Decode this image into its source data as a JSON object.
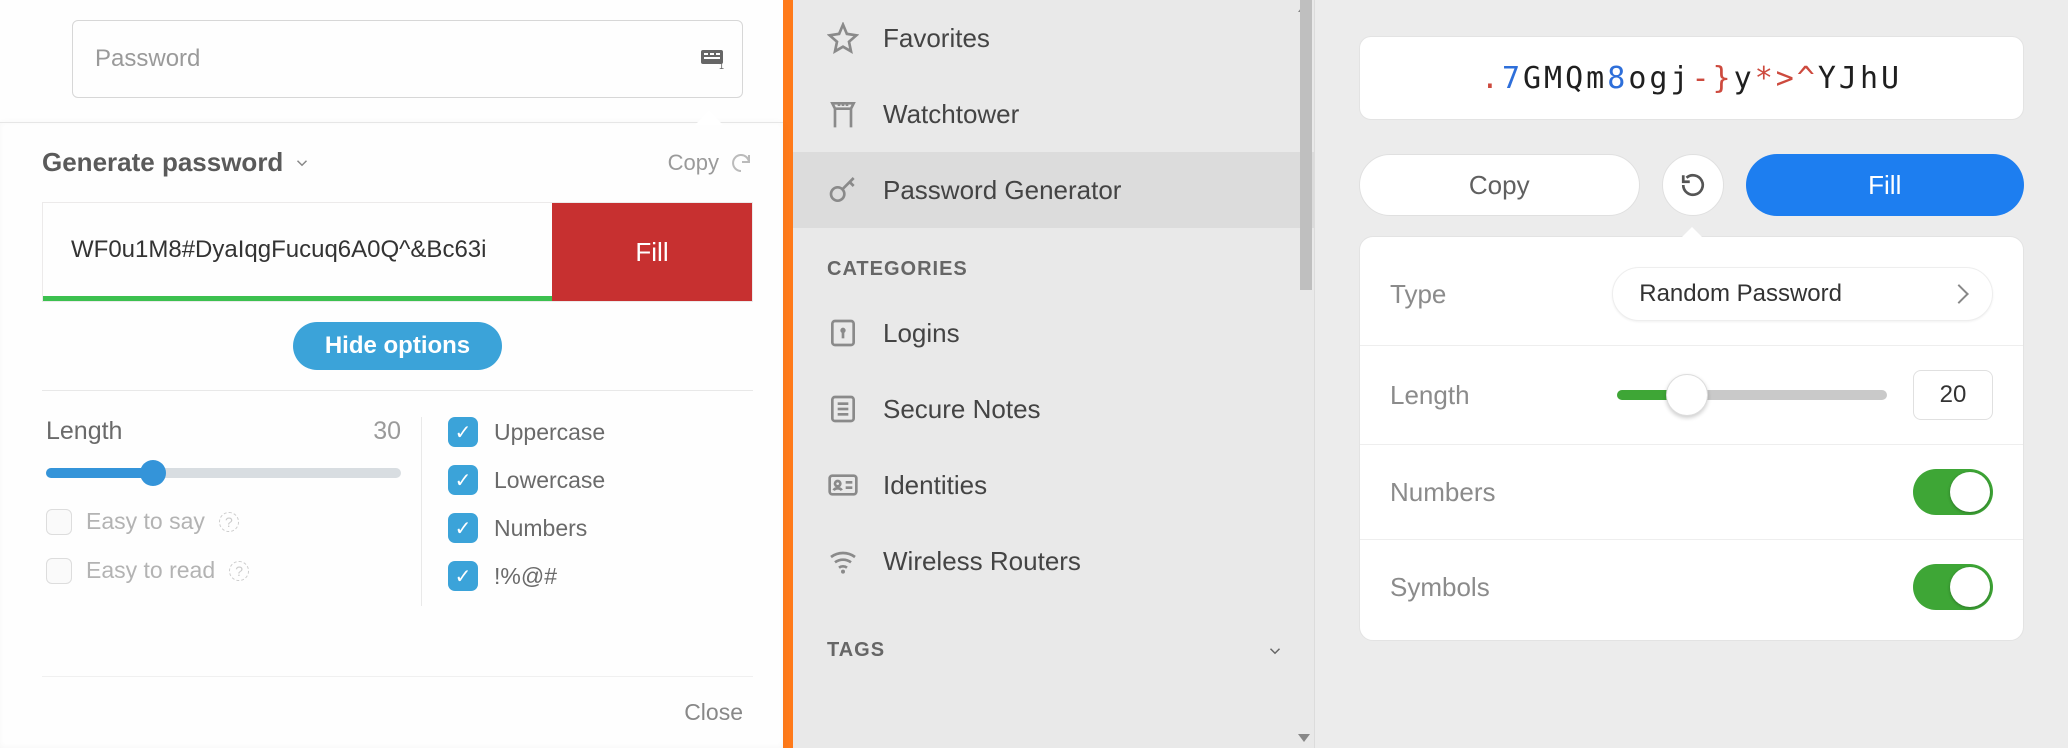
{
  "left": {
    "input_placeholder": "Password",
    "title": "Generate password",
    "copy_label": "Copy",
    "password_value": "WF0u1M8#DyaIqgFucuq6A0Q^&Bc63i",
    "fill_label": "Fill",
    "hide_label": "Hide options",
    "length_label": "Length",
    "length_value": "30",
    "easy_say": "Easy to say",
    "easy_read": "Easy to read",
    "cb_upper": "Uppercase",
    "cb_lower": "Lowercase",
    "cb_numbers": "Numbers",
    "cb_symbols": "!%@#",
    "close_label": "Close"
  },
  "mid": {
    "favorites": "Favorites",
    "watchtower": "Watchtower",
    "pwgen": "Password Generator",
    "categories": "CATEGORIES",
    "logins": "Logins",
    "notes": "Secure Notes",
    "identities": "Identities",
    "routers": "Wireless Routers",
    "tags": "TAGS"
  },
  "right": {
    "pw_segments": [
      {
        "t": ".",
        "c": "sym"
      },
      {
        "t": "7",
        "c": "num"
      },
      {
        "t": "GMQm",
        "c": "let"
      },
      {
        "t": "8",
        "c": "num"
      },
      {
        "t": "ogj",
        "c": "let"
      },
      {
        "t": "-}",
        "c": "sym"
      },
      {
        "t": "y",
        "c": "let"
      },
      {
        "t": "*>^",
        "c": "sym"
      },
      {
        "t": "YJhU",
        "c": "let"
      }
    ],
    "copy_label": "Copy",
    "fill_label": "Fill",
    "type_label": "Type",
    "type_value": "Random Password",
    "length_label": "Length",
    "length_value": "20",
    "numbers_label": "Numbers",
    "symbols_label": "Symbols"
  }
}
